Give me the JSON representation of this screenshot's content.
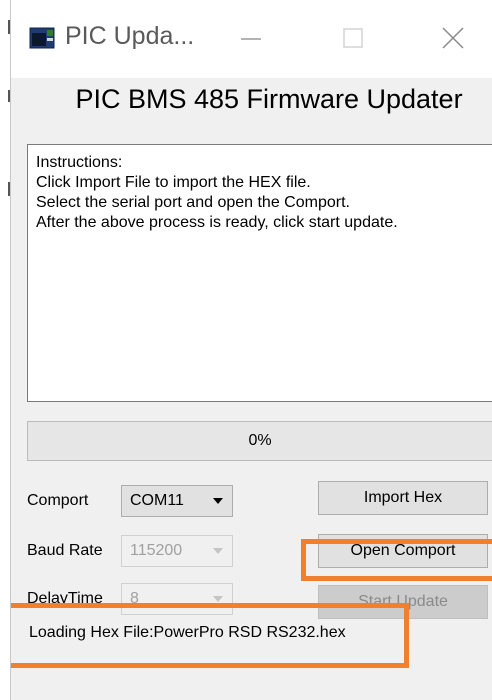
{
  "window": {
    "title": "PIC Upda...",
    "icon": "app-window-icon",
    "controls": [
      "minimize-icon",
      "maximize-icon",
      "close-icon"
    ]
  },
  "heading": "PIC BMS 485 Firmware Updater",
  "instructions": {
    "lines": [
      "Instructions:",
      "Click Import File to import the HEX file.",
      "Select the serial port and open the Comport.",
      "After the above process is ready, click start update."
    ]
  },
  "progress": {
    "text": "0%",
    "value": 0
  },
  "settings": {
    "comport": {
      "label": "Comport",
      "value": "COM11",
      "enabled": true
    },
    "baud_rate": {
      "label": "Baud Rate",
      "value": "115200",
      "enabled": false
    },
    "delay_time": {
      "label": "DelayTime",
      "value": "8",
      "enabled": false
    }
  },
  "buttons": {
    "import_hex": "Import Hex",
    "open_comport": "Open Comport",
    "start_update": "Start Update"
  },
  "status": "Loading Hex File:PowerPro RSD RS232.hex",
  "colors": {
    "highlight": "#f07f2e",
    "window_bg": "#f0f0f0",
    "button_bg": "#e1e1e1"
  }
}
